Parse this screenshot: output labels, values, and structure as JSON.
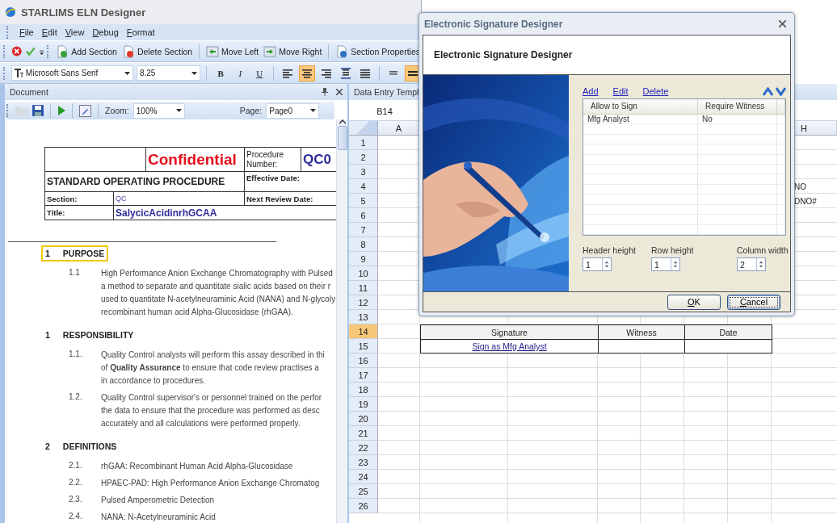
{
  "window": {
    "title": "STARLIMS ELN Designer"
  },
  "menu": [
    {
      "label": "File"
    },
    {
      "label": "Edit"
    },
    {
      "label": "View"
    },
    {
      "label": "Debug"
    },
    {
      "label": "Format"
    }
  ],
  "toolbar": {
    "actions": [
      {
        "kind": "add",
        "label": "Add Section"
      },
      {
        "kind": "delete",
        "label": "Delete Section"
      },
      {
        "kind": "left",
        "label": "Move Left"
      },
      {
        "kind": "right",
        "label": "Move Right"
      },
      {
        "kind": "properties",
        "label": "Section Properties"
      }
    ]
  },
  "format_bar": {
    "font": "Microsoft Sans Serif",
    "size": "8.25",
    "styles": [
      {
        "kind": "bold",
        "label": "B"
      },
      {
        "kind": "italic",
        "label": "I"
      },
      {
        "kind": "underline",
        "label": "U"
      }
    ],
    "alignments": [
      {
        "kind": "left",
        "selected": false
      },
      {
        "kind": "center",
        "selected": true
      },
      {
        "kind": "right",
        "selected": false
      },
      {
        "kind": "stretch",
        "selected": false
      },
      {
        "kind": "justify",
        "selected": false
      }
    ],
    "vertical": [
      {
        "kind": "top",
        "selected": false
      },
      {
        "kind": "middle",
        "selected": true
      }
    ]
  },
  "document_panel": {
    "title": "Document",
    "zoom_label": "Zoom:",
    "zoom": "100%",
    "page_label": "Page:",
    "page": "Page0",
    "header": {
      "confidential": "Confidential",
      "procedure_label": "Procedure Number:",
      "procedure_number": "QC0",
      "doc_type": "STANDARD OPERATING PROCEDURE",
      "effective_label": "Effective Date:",
      "section_label": "Section:",
      "section_value": "QC",
      "review_label": "Next  Review Date:",
      "title_label": "Title:",
      "title_value": "SalycicAcidinrhGCAA"
    },
    "sections": [
      {
        "number": "1",
        "heading": "PURPOSE",
        "highlighted": true,
        "items": [
          {
            "number": "1.1",
            "lines": [
              "High Performance Anion Exchange Chromatography with Pulsed",
              "a method to separate and quantitate sialic acids based on their r",
              "used to quantitate N-acetylneuraminic Acid (NANA)  and N-glycoly",
              "recombinant human acid Alpha-Glucosidase (rhGAA)."
            ]
          }
        ]
      },
      {
        "number": "1",
        "heading": "RESPONSIBILITY",
        "highlighted": false,
        "items": [
          {
            "number": "1.1.",
            "lines": [
              "Quality Control analysts will perform this assay described in thi",
              "of **Quality Assurance**  to ensure that code review practises a",
              "in accordance to procedures."
            ]
          },
          {
            "number": "1.2.",
            "lines": [
              "Quality Control supervisor's or personnel trained on the perfor",
              "the data to ensure that the procedure was performed as desc",
              "accurately and all calculations were performed properly."
            ]
          }
        ]
      },
      {
        "number": "2",
        "heading": "DEFINITIONS",
        "highlighted": false,
        "items": [
          {
            "number": "2.1.",
            "lines": [
              "rhGAA: Recombinant Human Acid Alpha-Glucosidase"
            ]
          },
          {
            "number": "2.2.",
            "lines": [
              "HPAEC-PAD: High Performance Anion Exchange Chromatog"
            ]
          },
          {
            "number": "2.3.",
            "lines": [
              "Pulsed Amperometric Detection"
            ]
          },
          {
            "number": "2.4.",
            "lines": [
              "NANA: N-Acetylneuraminic Acid"
            ]
          }
        ]
      }
    ]
  },
  "template_panel": {
    "title": "Data Entry Templ",
    "cell_ref": "B14",
    "columns": [
      {
        "label": "A"
      },
      {
        "label": "H"
      }
    ],
    "signature_table": {
      "headers": [
        "Signature",
        "Witness",
        "Date"
      ],
      "link": "Sign as Mfg Analyst"
    },
    "rows": [
      {
        "number": "1",
        "selected": false
      },
      {
        "number": "2",
        "selected": false
      },
      {
        "number": "3",
        "selected": false
      },
      {
        "number": "4",
        "selected": false,
        "h": "NO"
      },
      {
        "number": "5",
        "selected": false,
        "h": "DNO#"
      },
      {
        "number": "6",
        "selected": false
      },
      {
        "number": "7",
        "selected": false
      },
      {
        "number": "8",
        "selected": false
      },
      {
        "number": "9",
        "selected": false
      },
      {
        "number": "10",
        "selected": false
      },
      {
        "number": "11",
        "selected": false
      },
      {
        "number": "12",
        "selected": false
      },
      {
        "number": "13",
        "selected": false
      },
      {
        "number": "14",
        "selected": true,
        "kind": "signature-header"
      },
      {
        "number": "15",
        "selected": false,
        "kind": "signature-link"
      },
      {
        "number": "16",
        "selected": false
      },
      {
        "number": "17",
        "selected": false
      },
      {
        "number": "18",
        "selected": false
      },
      {
        "number": "19",
        "selected": false
      },
      {
        "number": "20",
        "selected": false
      },
      {
        "number": "21",
        "selected": false
      },
      {
        "number": "22",
        "selected": false
      },
      {
        "number": "23",
        "selected": false
      },
      {
        "number": "24",
        "selected": false
      },
      {
        "number": "25",
        "selected": false
      },
      {
        "number": "26",
        "selected": false
      }
    ]
  },
  "dialog": {
    "title": "Electronic Signature Designer",
    "heading": "Electronic Signature Designer",
    "links": [
      "Add",
      "Edit",
      "Delete"
    ],
    "columns": [
      "Allow to Sign",
      "Require Witness"
    ],
    "rows": [
      [
        "Mfg Analyst",
        "No"
      ]
    ],
    "spinners": [
      {
        "label": "Header height",
        "value": "1"
      },
      {
        "label": "Row height",
        "value": "1"
      },
      {
        "label": "Column width",
        "value": "2"
      }
    ],
    "buttons": [
      {
        "label": "OK",
        "focused": false
      },
      {
        "label": "Cancel",
        "focused": true
      }
    ]
  }
}
